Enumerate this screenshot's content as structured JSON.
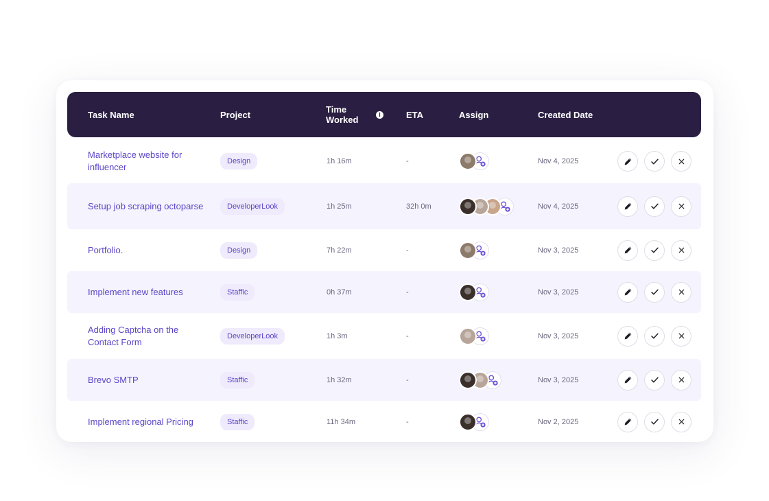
{
  "header": {
    "task_name": "Task Name",
    "project": "Project",
    "time_worked": "Time Worked",
    "eta": "ETA",
    "assign": "Assign",
    "created_date": "Created Date"
  },
  "colors": {
    "header_bg": "#2a1f42",
    "accent": "#5b45c7",
    "pill_bg": "#efeafc",
    "alt_row_bg": "#f5f3fd"
  },
  "icons": [
    "info-icon",
    "add-user-icon",
    "pencil-icon",
    "check-icon",
    "close-icon"
  ],
  "rows": [
    {
      "task": "Marketplace website for influencer",
      "project": "Design",
      "time": "1h 16m",
      "eta": "-",
      "date": "Nov 4, 2025",
      "avatars": [
        "#8c7a6b"
      ]
    },
    {
      "task": "Setup job scraping octoparse",
      "project": "DeveloperLook",
      "time": "1h 25m",
      "eta": "32h 0m",
      "date": "Nov 4, 2025",
      "avatars": [
        "#3a2f2a",
        "#b8a59a",
        "#c9a58c"
      ]
    },
    {
      "task": "Portfolio.",
      "project": "Design",
      "time": "7h 22m",
      "eta": "-",
      "date": "Nov 3, 2025",
      "avatars": [
        "#8c7a6b"
      ]
    },
    {
      "task": "Implement new features",
      "project": "Staffic",
      "time": "0h 37m",
      "eta": "-",
      "date": "Nov 3, 2025",
      "avatars": [
        "#3a2f2a"
      ]
    },
    {
      "task": "Adding Captcha on the Contact Form",
      "project": "DeveloperLook",
      "time": "1h 3m",
      "eta": "-",
      "date": "Nov 3, 2025",
      "avatars": [
        "#b8a59a"
      ]
    },
    {
      "task": "Brevo SMTP",
      "project": "Staffic",
      "time": "1h 32m",
      "eta": "-",
      "date": "Nov 3, 2025",
      "avatars": [
        "#3a2f2a",
        "#b8a59a"
      ]
    },
    {
      "task": "Implement regional Pricing",
      "project": "Staffic",
      "time": "11h 34m",
      "eta": "-",
      "date": "Nov 2, 2025",
      "avatars": [
        "#3a2f2a"
      ]
    }
  ]
}
